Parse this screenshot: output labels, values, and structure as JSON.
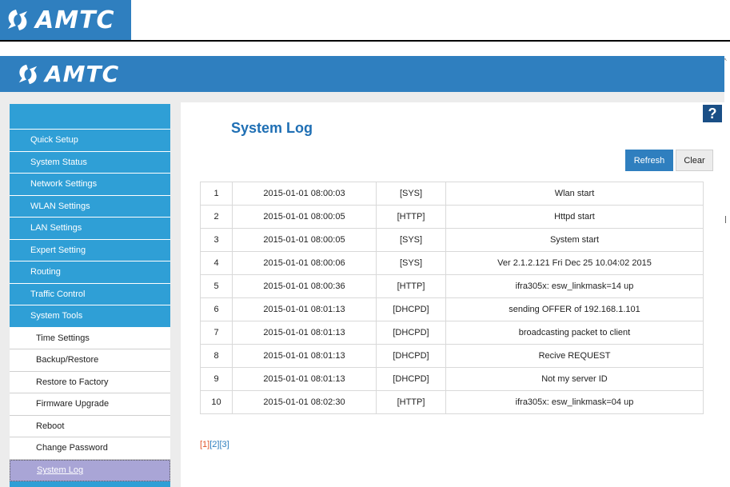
{
  "brand": {
    "name": "AMTC",
    "colors": {
      "header": "#2f7fbf",
      "sidebar": "#2f9fd6",
      "active": "#a9a5d6",
      "accent": "#1f6fb4",
      "page_current": "#e0552a"
    }
  },
  "sidebar": {
    "items": [
      {
        "label": "Quick Setup"
      },
      {
        "label": "System Status"
      },
      {
        "label": "Network Settings"
      },
      {
        "label": "WLAN Settings"
      },
      {
        "label": "LAN Settings"
      },
      {
        "label": "Expert Setting"
      },
      {
        "label": "Routing"
      },
      {
        "label": "Traffic Control"
      },
      {
        "label": "System Tools"
      }
    ],
    "subitems": [
      {
        "label": "Time Settings"
      },
      {
        "label": "Backup/Restore"
      },
      {
        "label": "Restore to Factory"
      },
      {
        "label": "Firmware Upgrade"
      },
      {
        "label": "Reboot"
      },
      {
        "label": "Change Password"
      },
      {
        "label": "System Log"
      }
    ]
  },
  "main": {
    "title": "System Log",
    "help_label": "?",
    "refresh_label": "Refresh",
    "clear_label": "Clear",
    "log_rows": [
      {
        "no": "1",
        "time": "2015-01-01 08:00:03",
        "type": "[SYS]",
        "message": "Wlan start"
      },
      {
        "no": "2",
        "time": "2015-01-01 08:00:05",
        "type": "[HTTP]",
        "message": "Httpd start"
      },
      {
        "no": "3",
        "time": "2015-01-01 08:00:05",
        "type": "[SYS]",
        "message": "System start"
      },
      {
        "no": "4",
        "time": "2015-01-01 08:00:06",
        "type": "[SYS]",
        "message": "Ver 2.1.2.121 Fri Dec 25 10.04:02 2015"
      },
      {
        "no": "5",
        "time": "2015-01-01 08:00:36",
        "type": "[HTTP]",
        "message": "ifra305x: esw_linkmask=14 up"
      },
      {
        "no": "6",
        "time": "2015-01-01 08:01:13",
        "type": "[DHCPD]",
        "message": "sending OFFER of 192.168.1.101"
      },
      {
        "no": "7",
        "time": "2015-01-01 08:01:13",
        "type": "[DHCPD]",
        "message": "broadcasting packet to client"
      },
      {
        "no": "8",
        "time": "2015-01-01 08:01:13",
        "type": "[DHCPD]",
        "message": "Recive REQUEST"
      },
      {
        "no": "9",
        "time": "2015-01-01 08:01:13",
        "type": "[DHCPD]",
        "message": "Not my server ID"
      },
      {
        "no": "10",
        "time": "2015-01-01 08:02:30",
        "type": "[HTTP]",
        "message": "ifra305x: esw_linkmask=04 up"
      }
    ],
    "pager": {
      "current": "[1]",
      "pages": [
        "[2]",
        "[3]"
      ]
    }
  }
}
